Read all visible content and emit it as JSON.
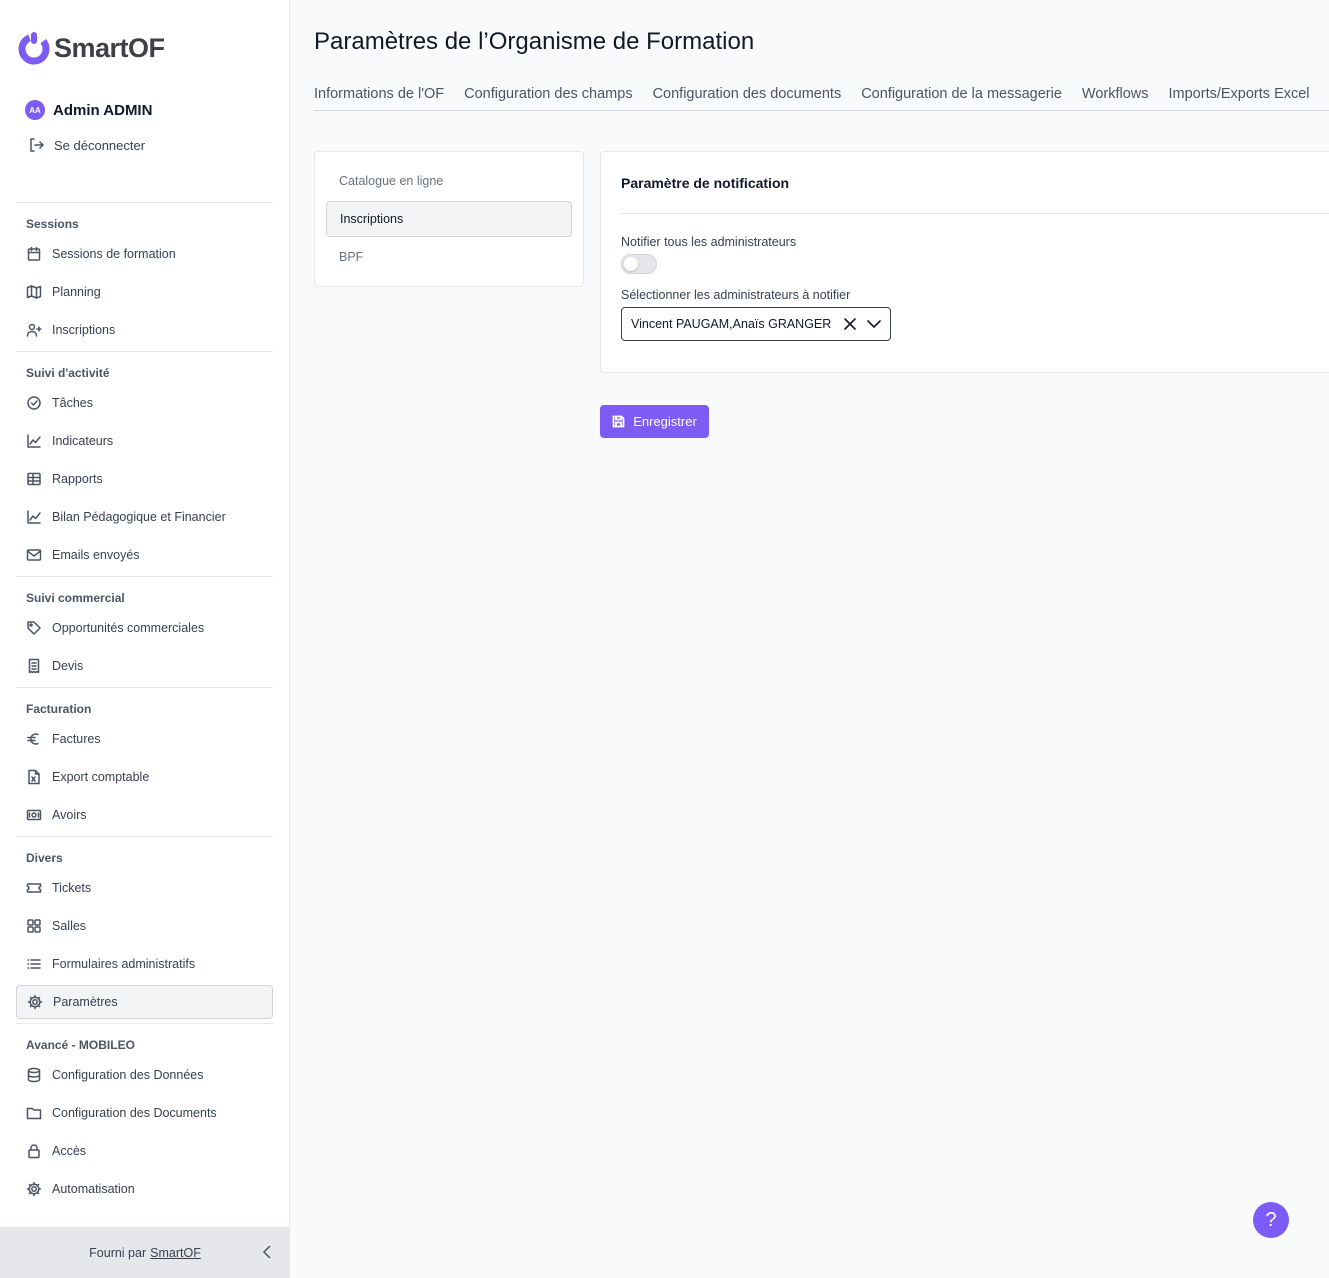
{
  "brand": {
    "name": "SmartOF",
    "accent": "#7c5cf5"
  },
  "user": {
    "initials": "AA",
    "name": "Admin ADMIN",
    "logout_label": "Se déconnecter"
  },
  "nav": {
    "sections": [
      {
        "title": "Sessions",
        "items": [
          {
            "label": "Sessions de formation",
            "icon": "calendar-icon"
          },
          {
            "label": "Planning",
            "icon": "map-icon"
          },
          {
            "label": "Inscriptions",
            "icon": "user-plus-icon"
          }
        ]
      },
      {
        "title": "Suivi d'activité",
        "items": [
          {
            "label": "Tâches",
            "icon": "check-circle-icon"
          },
          {
            "label": "Indicateurs",
            "icon": "chart-line-icon"
          },
          {
            "label": "Rapports",
            "icon": "table-icon"
          },
          {
            "label": "Bilan Pédagogique et Financier",
            "icon": "chart-line-icon"
          },
          {
            "label": "Emails envoyés",
            "icon": "mail-icon"
          }
        ]
      },
      {
        "title": "Suivi commercial",
        "items": [
          {
            "label": "Opportunités commerciales",
            "icon": "tag-icon"
          },
          {
            "label": "Devis",
            "icon": "receipt-icon"
          }
        ]
      },
      {
        "title": "Facturation",
        "items": [
          {
            "label": "Factures",
            "icon": "euro-icon"
          },
          {
            "label": "Export comptable",
            "icon": "file-excel-icon"
          },
          {
            "label": "Avoirs",
            "icon": "banknote-icon"
          }
        ]
      },
      {
        "title": "Divers",
        "items": [
          {
            "label": "Tickets",
            "icon": "ticket-icon"
          },
          {
            "label": "Salles",
            "icon": "grid-icon"
          },
          {
            "label": "Formulaires administratifs",
            "icon": "list-icon"
          },
          {
            "label": "Paramètres",
            "icon": "gear-icon",
            "active": true
          }
        ]
      },
      {
        "title": "Avancé - MOBILEO",
        "items": [
          {
            "label": "Configuration des Données",
            "icon": "database-icon"
          },
          {
            "label": "Configuration des Documents",
            "icon": "folder-icon"
          },
          {
            "label": "Accès",
            "icon": "lock-icon"
          },
          {
            "label": "Automatisation",
            "icon": "gear-icon"
          }
        ]
      }
    ]
  },
  "footer": {
    "prefix": "Fourni par",
    "link": "SmartOF"
  },
  "page": {
    "title": "Paramètres de l’Organisme de Formation",
    "tabs": [
      "Informations de l'OF",
      "Configuration des champs",
      "Configuration des documents",
      "Configuration de la messagerie",
      "Workflows",
      "Imports/Exports Excel"
    ]
  },
  "subnav": {
    "items": [
      "Catalogue en ligne",
      "Inscriptions",
      "BPF"
    ],
    "active_index": 1
  },
  "panel": {
    "title": "Paramètre de notification",
    "notify_all_label": "Notifier tous les administrateurs",
    "notify_all_value": false,
    "select_label": "Sélectionner les administrateurs à notifier",
    "select_value": "Vincent PAUGAM,Anaïs GRANGER"
  },
  "save_label": "Enregistrer",
  "help_label": "?"
}
